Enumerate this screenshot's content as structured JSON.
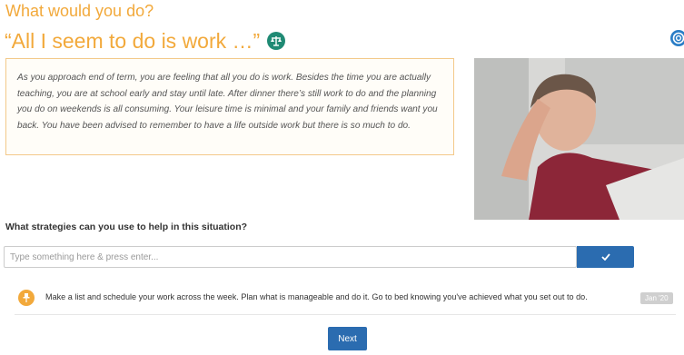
{
  "header": {
    "kicker": "What would you do?",
    "title": "“All I seem to do is work …”",
    "title_icon": "scales-icon",
    "help_icon": "life-ring-icon"
  },
  "scenario": {
    "text": "As you approach end of term, you are feeling that all you do is work. Besides the time you are actually teaching, you are at school early and stay until late. After dinner there’s still work to do and the planning you do on weekends is all consuming. Your leisure time is minimal and your family and friends want you back. You have been advised to remember to have a life outside work but there is so much to do."
  },
  "prompt": {
    "question": "What strategies can you use to help in this situation?",
    "input_value": "",
    "input_placeholder": "Type something here & press enter...",
    "submit_icon": "checkmark-icon"
  },
  "responses": [
    {
      "icon": "pin-icon",
      "text": "Make a list and schedule your work across the week. Plan what is manageable and do it. Go to bed knowing you've achieved what you set out to do.",
      "date": "Jan '20"
    }
  ],
  "footer": {
    "next_label": "Next"
  },
  "colors": {
    "accent": "#f2a93b",
    "primary_button": "#2b6cb0",
    "icon_green": "#1f8a74",
    "help_blue": "#2a7dc6"
  }
}
